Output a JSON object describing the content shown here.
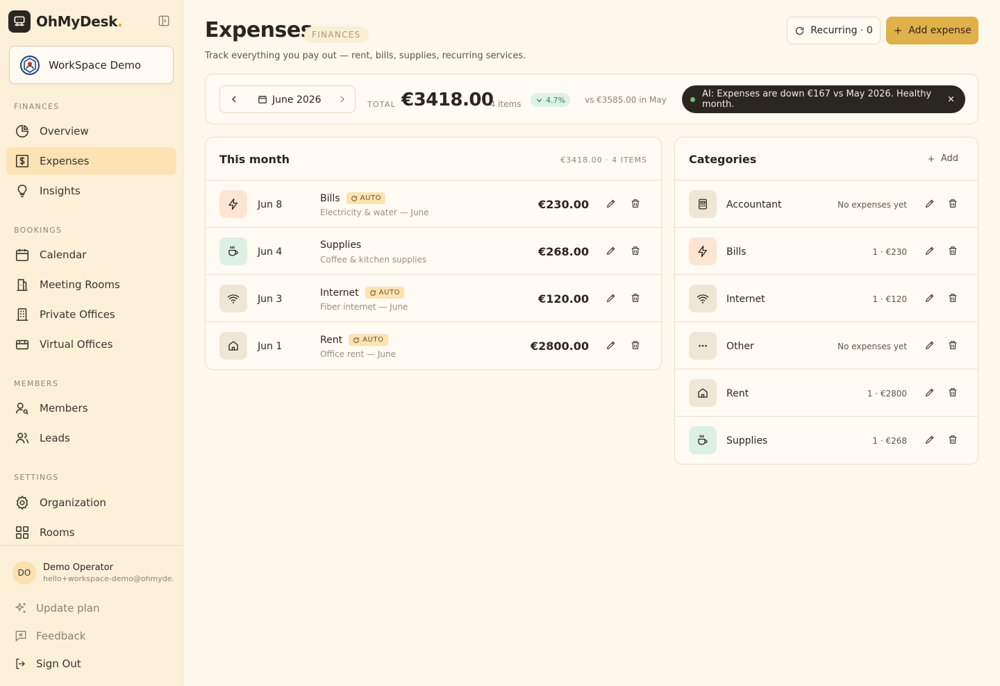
{
  "app": {
    "brand": "OhMyDesk",
    "brand_dot": ".",
    "workspace": "WorkSpace Demo"
  },
  "sidebar": {
    "sections": [
      {
        "label": "FINANCES",
        "items": [
          {
            "label": "Overview",
            "icon": "pie-chart-icon"
          },
          {
            "label": "Expenses",
            "icon": "receipt-dollar-icon",
            "active": true
          },
          {
            "label": "Insights",
            "icon": "lightbulb-icon"
          }
        ]
      },
      {
        "label": "BOOKINGS",
        "items": [
          {
            "label": "Calendar",
            "icon": "calendar-icon"
          },
          {
            "label": "Meeting Rooms",
            "icon": "meeting-room-icon"
          },
          {
            "label": "Private Offices",
            "icon": "building-icon"
          },
          {
            "label": "Virtual Offices",
            "icon": "id-card-icon"
          }
        ]
      },
      {
        "label": "MEMBERS",
        "items": [
          {
            "label": "Members",
            "icon": "user-search-icon"
          },
          {
            "label": "Leads",
            "icon": "users-icon"
          }
        ]
      },
      {
        "label": "SETTINGS",
        "items": [
          {
            "label": "Organization",
            "icon": "gear-icon"
          },
          {
            "label": "Rooms",
            "icon": "grid-icon"
          }
        ]
      }
    ],
    "user": {
      "initials": "DO",
      "name": "Demo Operator",
      "email": "hello+workspace-demo@ohmyde."
    },
    "footer": [
      {
        "label": "Update plan",
        "icon": "sparkles-icon"
      },
      {
        "label": "Feedback",
        "icon": "message-icon"
      },
      {
        "label": "Sign Out",
        "icon": "sign-out-icon"
      }
    ]
  },
  "header": {
    "title": "Expenses",
    "badge": "FINANCES",
    "subtitle": "Track everything you pay out — rent, bills, supplies, recurring services.",
    "recurring_label": "Recurring · 0",
    "add_label": "Add expense"
  },
  "summary": {
    "month": "June 2026",
    "total_label": "TOTAL",
    "total_value": "€3418.00",
    "items": "· 4 items",
    "trend": "4.7%",
    "vs": "vs €3585.00 in May",
    "ai_text": "AI: Expenses are down €167 vs May 2026. Healthy month."
  },
  "this_month": {
    "title": "This month",
    "meta": "€3418.00 · 4 ITEMS",
    "auto_label": "AUTO",
    "rows": [
      {
        "date": "Jun 8",
        "name": "Bills",
        "auto": true,
        "desc": "Electricity & water — June",
        "amount": "€230.00",
        "icon": "lightning-icon",
        "tint": "#fde4d3"
      },
      {
        "date": "Jun 4",
        "name": "Supplies",
        "auto": false,
        "desc": "Coffee & kitchen supplies",
        "amount": "€268.00",
        "icon": "coffee-icon",
        "tint": "#dcf0e5"
      },
      {
        "date": "Jun 3",
        "name": "Internet",
        "auto": true,
        "desc": "Fiber internet — June",
        "amount": "€120.00",
        "icon": "wifi-icon",
        "tint": "#efe6d6"
      },
      {
        "date": "Jun 1",
        "name": "Rent",
        "auto": true,
        "desc": "Office rent — June",
        "amount": "€2800.00",
        "icon": "home-icon",
        "tint": "#efe6d6"
      }
    ]
  },
  "categories": {
    "title": "Categories",
    "add_label": "Add",
    "rows": [
      {
        "name": "Accountant",
        "stat": "No expenses yet",
        "icon": "calculator-icon",
        "tint": "#efe6d6"
      },
      {
        "name": "Bills",
        "stat": "1 · €230",
        "icon": "lightning-icon",
        "tint": "#fde4d3"
      },
      {
        "name": "Internet",
        "stat": "1 · €120",
        "icon": "wifi-icon",
        "tint": "#efe6d6"
      },
      {
        "name": "Other",
        "stat": "No expenses yet",
        "icon": "dots-icon",
        "tint": "#efe6d6"
      },
      {
        "name": "Rent",
        "stat": "1 · €2800",
        "icon": "home-icon",
        "tint": "#efe6d6"
      },
      {
        "name": "Supplies",
        "stat": "1 · €268",
        "icon": "coffee-icon",
        "tint": "#dcf0e5"
      }
    ]
  },
  "colors": {
    "accent": "#e0b04a",
    "sidebar_bg": "#fdf0d9",
    "active_bg": "#fde2b4",
    "trend_green": "#2e8b57"
  }
}
